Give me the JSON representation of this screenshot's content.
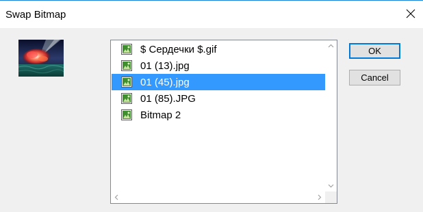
{
  "window": {
    "title": "Swap Bitmap"
  },
  "icons": {
    "close": "close-icon",
    "file": "bitmap-file-icon"
  },
  "list": {
    "items": [
      {
        "label": "$ Сердечки $.gif",
        "selected": false
      },
      {
        "label": "01 (13).jpg",
        "selected": false
      },
      {
        "label": "01 (45).jpg",
        "selected": true
      },
      {
        "label": "01 (85).JPG",
        "selected": false
      },
      {
        "label": "Bitmap 2",
        "selected": false
      }
    ]
  },
  "buttons": {
    "ok": "OK",
    "cancel": "Cancel"
  },
  "colors": {
    "selection": "#3399ff",
    "accent": "#0078d7",
    "dialog_bg": "#f0f0f0"
  }
}
